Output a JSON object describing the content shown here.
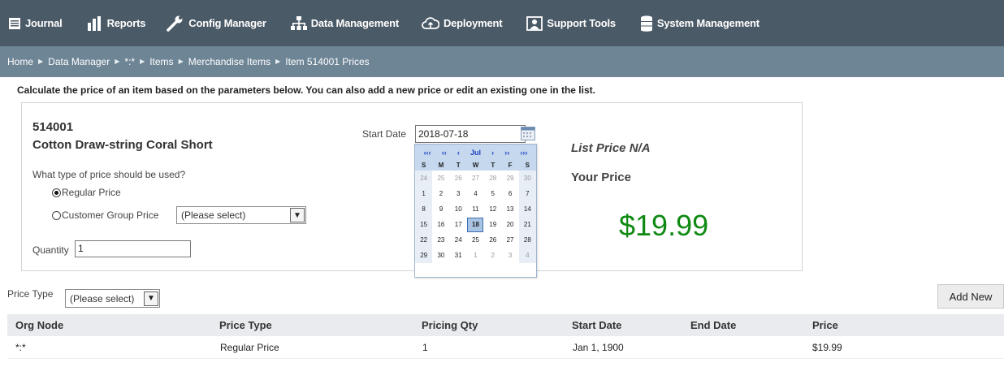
{
  "nav": {
    "items": [
      {
        "label": "Journal",
        "icon": "journal-icon"
      },
      {
        "label": "Reports",
        "icon": "bar-chart-icon"
      },
      {
        "label": "Config Manager",
        "icon": "wrench-icon"
      },
      {
        "label": "Data Management",
        "icon": "hierarchy-icon"
      },
      {
        "label": "Deployment",
        "icon": "cloud-upload-icon"
      },
      {
        "label": "Support Tools",
        "icon": "support-icon"
      },
      {
        "label": "System Management",
        "icon": "database-icon"
      }
    ]
  },
  "breadcrumb": [
    "Home",
    "Data Manager",
    "*:*",
    "Items",
    "Merchandise Items",
    "Item 514001 Prices"
  ],
  "intro": "Calculate the price of an item based on the parameters below. You can also add a new price or edit an existing one in the list.",
  "calc": {
    "item_id": "514001",
    "item_name": "Cotton Draw-string Coral Short",
    "price_question": "What type of price should be used?",
    "regular_label": "Regular Price",
    "customer_group_label": "Customer Group Price",
    "customer_group_select": "(Please select)",
    "quantity_label": "Quantity",
    "quantity_value": "1",
    "start_date_label": "Start Date",
    "start_date_value": "2018-07-18",
    "list_price": "List Price N/A",
    "your_price_label": "Your Price",
    "your_price_value": "$19.99"
  },
  "calendar": {
    "nav": [
      "‹‹‹",
      "‹‹",
      "‹",
      "Jul",
      "›",
      "››",
      "›››"
    ],
    "dows": [
      "S",
      "M",
      "T",
      "W",
      "T",
      "F",
      "S"
    ],
    "weeks": [
      [
        "24",
        "25",
        "26",
        "27",
        "28",
        "29",
        "30"
      ],
      [
        "1",
        "2",
        "3",
        "4",
        "5",
        "6",
        "7"
      ],
      [
        "8",
        "9",
        "10",
        "11",
        "12",
        "13",
        "14"
      ],
      [
        "15",
        "16",
        "17",
        "18",
        "19",
        "20",
        "21"
      ],
      [
        "22",
        "23",
        "24",
        "25",
        "26",
        "27",
        "28"
      ],
      [
        "29",
        "30",
        "31",
        "1",
        "2",
        "3",
        "4"
      ]
    ],
    "selected": "18"
  },
  "filter": {
    "price_type_label": "Price Type",
    "price_type_select": "(Please select)",
    "add_new_label": "Add New"
  },
  "table": {
    "headers": [
      "Org Node",
      "Price Type",
      "Pricing Qty",
      "Start Date",
      "End Date",
      "Price"
    ],
    "rows": [
      [
        "*:*",
        "Regular Price",
        "1",
        "Jan 1, 1900",
        "",
        "$19.99"
      ]
    ]
  }
}
